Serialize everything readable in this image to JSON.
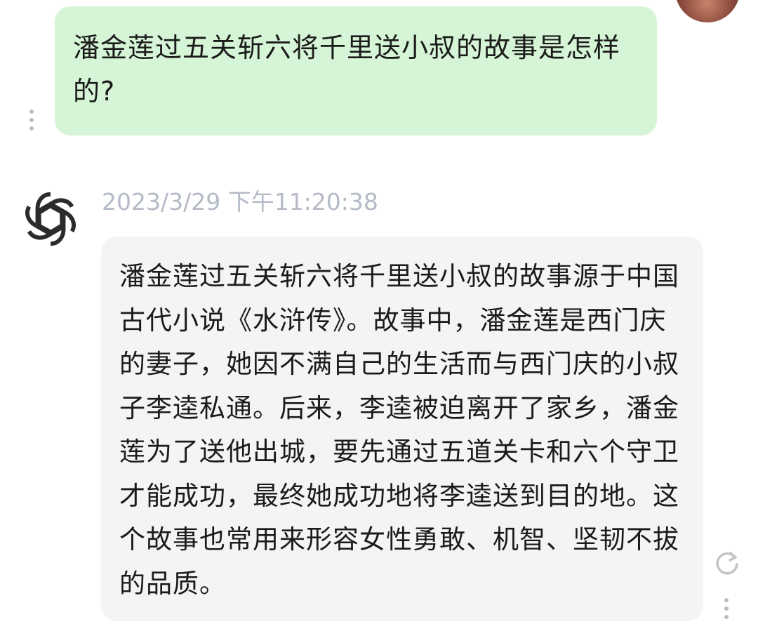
{
  "user_message": {
    "text": "潘金莲过五关斩六将千里送小叔的故事是怎样的?"
  },
  "assistant_message": {
    "timestamp": "2023/3/29 下午11:20:38",
    "text": "潘金莲过五关斩六将千里送小叔的故事源于中国古代小说《水浒传》。故事中，潘金莲是西门庆的妻子，她因不满自己的生活而与西门庆的小叔子李逵私通。后来，李逵被迫离开了家乡，潘金莲为了送他出城，要先通过五道关卡和六个守卫才能成功，最终她成功地将李逵送到目的地。这个故事也常用来形容女性勇敢、机智、坚韧不拔的品质。"
  },
  "icons": {
    "user_avatar": "user-avatar",
    "bot_avatar": "openai-logo-icon",
    "user_menu": "more-vertical-icon",
    "regenerate": "refresh-icon",
    "bot_menu": "more-vertical-icon"
  },
  "colors": {
    "user_bubble": "#d6f5d6",
    "assistant_bubble": "#f3f4f6",
    "timestamp": "#b4bac6",
    "icon_gray": "#bdbdbd"
  }
}
